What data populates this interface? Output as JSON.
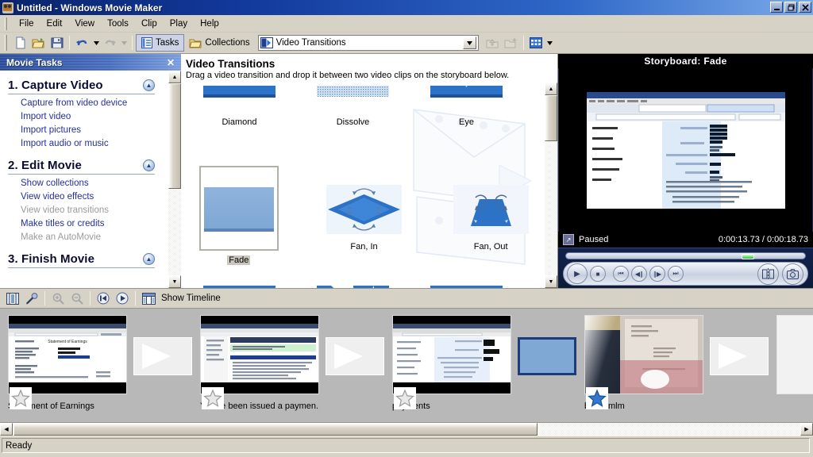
{
  "window": {
    "title": "Untitled - Windows Movie Maker",
    "icon": "movie-reel-icon",
    "buttons": {
      "minimize": "_",
      "restore": "❐",
      "close": "✕"
    }
  },
  "menubar": {
    "items": [
      "File",
      "Edit",
      "View",
      "Tools",
      "Clip",
      "Play",
      "Help"
    ]
  },
  "toolbar": {
    "new_label": "new-project-icon",
    "open_label": "open-project-icon",
    "save_label": "save-project-icon",
    "undo_label": "undo-icon",
    "redo_label": "redo-icon",
    "tasks_label": "Tasks",
    "collections_label": "Collections",
    "collection_combo_value": "Video Transitions",
    "up_one_level": "up-one-level-icon",
    "new_collection": "new-collection-icon",
    "views_label": "views-icon"
  },
  "tasks_pane": {
    "header": "Movie Tasks",
    "close": "✕",
    "groups": [
      {
        "title": "1. Capture Video",
        "collapse_icon": "chevron-up-icon",
        "links": [
          {
            "label": "Capture from video device",
            "disabled": false
          },
          {
            "label": "Import video",
            "disabled": false
          },
          {
            "label": "Import pictures",
            "disabled": false
          },
          {
            "label": "Import audio or music",
            "disabled": false
          }
        ]
      },
      {
        "title": "2. Edit Movie",
        "collapse_icon": "chevron-up-icon",
        "links": [
          {
            "label": "Show collections",
            "disabled": false
          },
          {
            "label": "View video effects",
            "disabled": false
          },
          {
            "label": "View video transitions",
            "disabled": true
          },
          {
            "label": "Make titles or credits",
            "disabled": false
          },
          {
            "label": "Make an AutoMovie",
            "disabled": true
          }
        ]
      },
      {
        "title": "3. Finish Movie",
        "collapse_icon": "chevron-up-icon",
        "links": []
      }
    ]
  },
  "transitions_pane": {
    "title": "Video Transitions",
    "subtitle": "Drag a video transition and drop it between two video clips on the storyboard below.",
    "items": [
      {
        "label": "Diamond",
        "selected": false,
        "style": "diamond"
      },
      {
        "label": "Dissolve",
        "selected": false,
        "style": "dissolve"
      },
      {
        "label": "Eye",
        "selected": false,
        "style": "eye"
      },
      {
        "label": "Fade",
        "selected": true,
        "style": "fade"
      },
      {
        "label": "Fan, In",
        "selected": false,
        "style": "fan-in"
      },
      {
        "label": "Fan, Out",
        "selected": false,
        "style": "fan-out"
      }
    ]
  },
  "preview": {
    "title": "Storyboard: Fade",
    "expand_icon": "expand-icon",
    "state": "Paused",
    "timecode": "0:00:13.73 / 0:00:18.73",
    "controls": {
      "play": "play-icon",
      "stop": "stop-icon",
      "previous_frame": "skip-back-icon",
      "back_frame": "step-back-icon",
      "forward_frame": "step-forward-icon",
      "next_frame": "skip-forward-icon",
      "split": "split-clip-icon",
      "take_picture": "take-picture-icon"
    }
  },
  "storyboard_toolbar": {
    "storyboard_view_icon": "storyboard-view-icon",
    "narrate_icon": "narrate-timeline-icon",
    "zoom_in_icon": "zoom-in-icon",
    "zoom_out_icon": "zoom-out-icon",
    "rewind_icon": "rewind-storyboard-icon",
    "play_icon": "play-storyboard-icon",
    "show_timeline_icon": "show-timeline-icon",
    "show_timeline_label": "Show Timeline"
  },
  "storyboard": {
    "clips": [
      {
        "name": "Statement of Earnings",
        "star": "gray",
        "kind": "clip"
      },
      {
        "name": "",
        "kind": "transition-empty"
      },
      {
        "name": "You've been issued a paymen...",
        "star": "gray",
        "kind": "clip"
      },
      {
        "name": "",
        "kind": "transition-empty"
      },
      {
        "name": "payments",
        "star": "gray",
        "kind": "clip"
      },
      {
        "name": "",
        "kind": "transition-filled",
        "transition": "Fade",
        "selected": true
      },
      {
        "name": "bukanmlm",
        "star": "blue",
        "kind": "clip"
      },
      {
        "name": "",
        "kind": "transition-empty"
      },
      {
        "name": "",
        "kind": "empty"
      }
    ]
  },
  "statusbar": {
    "text": "Ready"
  },
  "colors": {
    "title_bar_start": "#0a246a",
    "title_bar_end": "#7aaae8",
    "chrome": "#d6d2c6",
    "link": "#232f9e",
    "disabled_link": "#9b9b9b",
    "storyboard_bg": "#b8b8b8",
    "transition_blue": "#2c72c7",
    "selection_border": "#1c3c7a",
    "fade_fill": "#7fa8d4"
  }
}
